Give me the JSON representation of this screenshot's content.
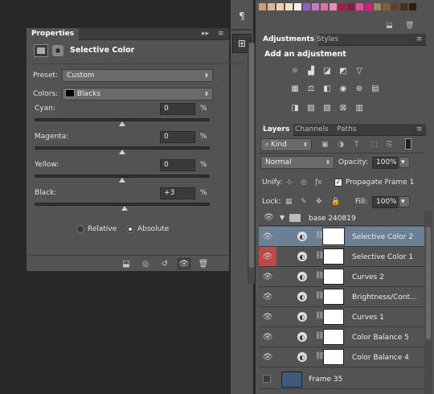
{
  "properties": {
    "tab": "Properties",
    "title": "Selective Color",
    "preset_label": "Preset:",
    "preset_value": "Custom",
    "colors_label": "Colors:",
    "colors_value": "Blacks",
    "sliders": [
      {
        "label": "Cyan:",
        "value": "0",
        "unit": "%",
        "level": 0
      },
      {
        "label": "Magenta:",
        "value": "0",
        "unit": "%",
        "level": 0
      },
      {
        "label": "Yellow:",
        "value": "0",
        "unit": "%",
        "level": 0
      },
      {
        "label": "Black:",
        "value": "+3",
        "unit": "%",
        "level": 3
      }
    ],
    "method_relative": "Relative",
    "method_absolute": "Absolute",
    "method_selected": "Absolute"
  },
  "adjustments": {
    "tab_active": "Adjustments",
    "tab_styles": "Styles",
    "heading": "Add an adjustment"
  },
  "layers": {
    "tab_layers": "Layers",
    "tab_channels": "Channels",
    "tab_paths": "Paths",
    "filter_kind": "Kind",
    "blend_mode": "Normal",
    "opacity_label": "Opacity:",
    "opacity_value": "100%",
    "unify_label": "Unify:",
    "propagate_label": "Propagate Frame 1",
    "lock_label": "Lock:",
    "fill_label": "Fill:",
    "fill_value": "100%",
    "group_name": "base 240819",
    "items": [
      {
        "name": "Selective Color 2",
        "selected": true
      },
      {
        "name": "Selective Color 1",
        "selected": false
      },
      {
        "name": "Curves 2",
        "selected": false
      },
      {
        "name": "Brightness/Cont...",
        "selected": false
      },
      {
        "name": "Curves 1",
        "selected": false
      },
      {
        "name": "Color Balance 5",
        "selected": false
      },
      {
        "name": "Color Balance 4",
        "selected": false
      }
    ],
    "frame_name": "Frame 35"
  },
  "colors": {
    "selected_row": "#6c7f96",
    "red_eye": "#b84a4a"
  }
}
